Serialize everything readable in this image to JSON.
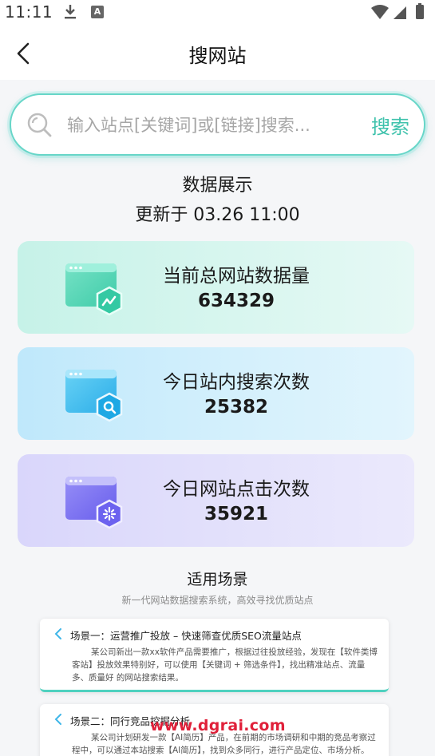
{
  "status": {
    "time": "11:11"
  },
  "header": {
    "title": "搜网站"
  },
  "search": {
    "placeholder": "输入站点[关键词]或[链接]搜索...",
    "button": "搜索"
  },
  "stats": {
    "title": "数据展示",
    "updated": "更新于 03.26 11:00",
    "cards": [
      {
        "label": "当前总网站数据量",
        "value": "634329",
        "icon": "website-chart-icon"
      },
      {
        "label": "今日站内搜索次数",
        "value": "25382",
        "icon": "website-search-icon"
      },
      {
        "label": "今日网站点击次数",
        "value": "35921",
        "icon": "website-click-icon"
      }
    ]
  },
  "scenes": {
    "title": "适用场景",
    "subtitle": "新一代网站数据搜索系统，高效寻找优质站点",
    "items": [
      {
        "title": "场景一：运营推广投放 – 快速筛查优质SEO流量站点",
        "body": "某公司新出一款xx软件产品需要推广，根据过往投放经验，发现在【软件类博客站】投放效果特别好，可以使用【关键词 + 筛选条件】，找出精准站点、流量多、质量好 的网站搜索结果。"
      },
      {
        "title": "场景二：同行竞品挖掘分析",
        "body": "某公司计划研发一款【AI简历】产品，在前期的市场调研和中期的竞品考察过程中，可以通过本站搜索【AI简历】，找到众多同行，进行产品定位、市场分析。"
      }
    ]
  },
  "watermark": "www.dgrai.com",
  "colors": {
    "accent": "#3fc2ac",
    "card1": "#c6f2e8",
    "card2": "#bfe8fb",
    "card3": "#d9d6fb",
    "watermark": "#e0213a"
  }
}
